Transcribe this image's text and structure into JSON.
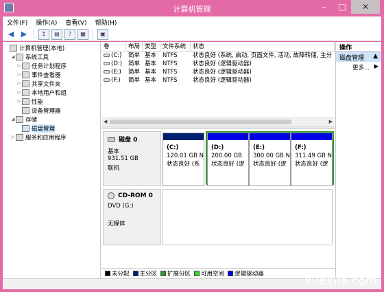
{
  "window": {
    "title": "计算机管理"
  },
  "menu": [
    "文件(F)",
    "操作(A)",
    "查看(V)",
    "帮助(H)"
  ],
  "tree": [
    {
      "label": "计算机管理(本地)",
      "level": 0,
      "expander": "",
      "icon": "computer-icon"
    },
    {
      "label": "系统工具",
      "level": 1,
      "expander": "◢",
      "icon": "tools-icon"
    },
    {
      "label": "任务计划程序",
      "level": 2,
      "expander": "▷",
      "icon": "clock-icon"
    },
    {
      "label": "事件查看器",
      "level": 2,
      "expander": "▷",
      "icon": "event-icon"
    },
    {
      "label": "共享文件夹",
      "level": 2,
      "expander": "▷",
      "icon": "folder-icon"
    },
    {
      "label": "本地用户和组",
      "level": 2,
      "expander": "▷",
      "icon": "users-icon"
    },
    {
      "label": "性能",
      "level": 2,
      "expander": "▷",
      "icon": "performance-icon"
    },
    {
      "label": "设备管理器",
      "level": 2,
      "expander": "",
      "icon": "device-icon"
    },
    {
      "label": "存储",
      "level": 1,
      "expander": "◢",
      "icon": "storage-icon"
    },
    {
      "label": "磁盘管理",
      "level": 2,
      "expander": "",
      "icon": "disk-icon",
      "selected": true
    },
    {
      "label": "服务和应用程序",
      "level": 1,
      "expander": "▷",
      "icon": "services-icon"
    }
  ],
  "volumes": {
    "headers": [
      "卷",
      "布局",
      "类型",
      "文件系统",
      "状态"
    ],
    "rows": [
      [
        "(C:)",
        "简单",
        "基本",
        "NTFS",
        "状态良好 (系统, 启动, 页面文件, 活动, 故障转储, 主分"
      ],
      [
        "(D:)",
        "简单",
        "基本",
        "NTFS",
        "状态良好 (逻辑驱动器)"
      ],
      [
        "(E:)",
        "简单",
        "基本",
        "NTFS",
        "状态良好 (逻辑驱动器)"
      ],
      [
        "(F:)",
        "简单",
        "基本",
        "NTFS",
        "状态良好 (逻辑驱动器)"
      ]
    ]
  },
  "disk0": {
    "name": "磁盘 0",
    "type": "基本",
    "size": "931.51 GB",
    "status": "联机",
    "partitions": [
      {
        "name": "(C:)",
        "size": "120.01 GB N",
        "status": "状态良好 (系",
        "kind": "primary"
      },
      {
        "name": "(D:)",
        "size": "200.00 GB",
        "status": "状态良好 (逻",
        "kind": "logical"
      },
      {
        "name": "(E:)",
        "size": "300.00 GB N",
        "status": "状态良好 (逻",
        "kind": "logical"
      },
      {
        "name": "(F:)",
        "size": "311.49 GB N",
        "status": "状态良好 (逻",
        "kind": "logical"
      }
    ]
  },
  "cdrom0": {
    "name": "CD-ROM 0",
    "drive": "DVD (G:)",
    "media": "无媒体"
  },
  "legend": [
    {
      "label": "未分配",
      "color": "#000000"
    },
    {
      "label": "主分区",
      "color": "#002070"
    },
    {
      "label": "扩展分区",
      "color": "#2f9a2f"
    },
    {
      "label": "可用空间",
      "color": "#33dd33"
    },
    {
      "label": "逻辑驱动器",
      "color": "#0000e8"
    }
  ],
  "actions": {
    "header": "操作",
    "section": "磁盘管理",
    "more": "更多..."
  },
  "watermark": "xuexila.com"
}
